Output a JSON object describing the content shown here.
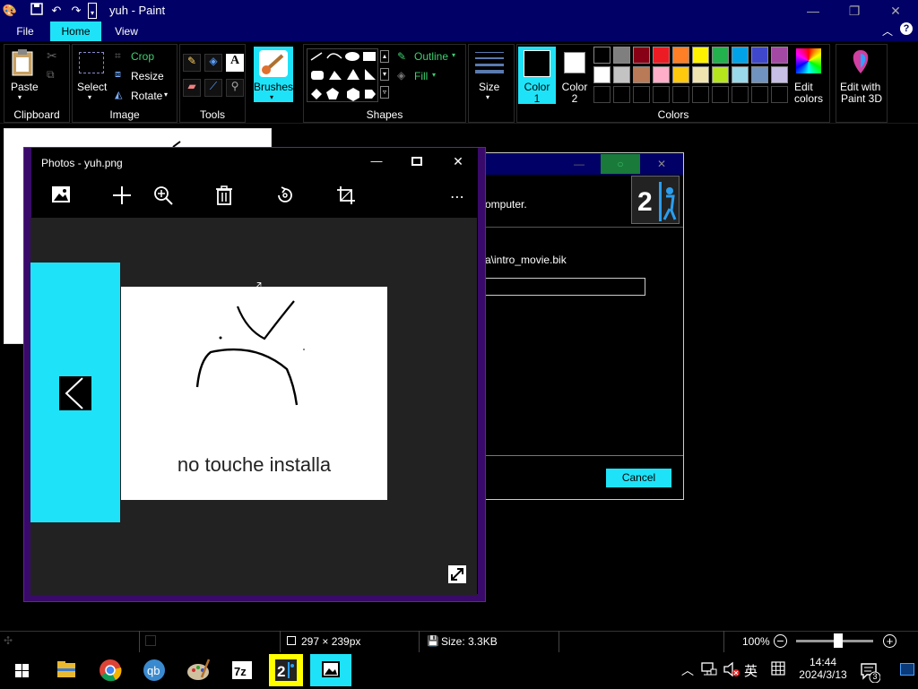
{
  "window": {
    "title": "yuh - Paint"
  },
  "menu": {
    "tabs": [
      {
        "label": "File"
      },
      {
        "label": "Home"
      },
      {
        "label": "View"
      }
    ]
  },
  "ribbon": {
    "clipboard": {
      "paste": "Paste",
      "group": "Clipboard"
    },
    "image": {
      "select": "Select",
      "crop": "Crop",
      "resize": "Resize",
      "rotate": "Rotate",
      "group": "Image"
    },
    "tools": {
      "group": "Tools"
    },
    "brushes": {
      "label": "Brushes"
    },
    "shapes": {
      "outline": "Outline",
      "fill": "Fill",
      "group": "Shapes"
    },
    "size": {
      "label": "Size"
    },
    "colors": {
      "color1": "Color\n1",
      "color1_a": "Color",
      "color1_b": "1",
      "color2_a": "Color",
      "color2_b": "2",
      "edit": "Edit",
      "edit2": "colors",
      "group": "Colors",
      "palette_row1": [
        "#000000",
        "#7f7f7f",
        "#880015",
        "#ed1c24",
        "#ff7f27",
        "#fff200",
        "#22b14c",
        "#00a2e8",
        "#3f48cc",
        "#a349a4"
      ],
      "palette_row2": [
        "#ffffff",
        "#c3c3c3",
        "#b97a57",
        "#ffaec9",
        "#ffc90e",
        "#efe4b0",
        "#b5e61d",
        "#99d9ea",
        "#7092be",
        "#c8bfe7"
      ]
    },
    "paint3d": {
      "line1": "Edit with",
      "line2": "Paint 3D"
    }
  },
  "installer": {
    "text1": "omputer.",
    "path": "a\\intro_movie.bik",
    "cancel": "Cancel"
  },
  "photos": {
    "title": "Photos - yuh.png",
    "image_caption": "no touche installa"
  },
  "statusbar": {
    "dimensions": "297 × 239px",
    "size": "Size: 3.3KB",
    "zoom": "100%",
    "zoom_level": 0.55
  },
  "taskbar": {
    "ime": "英",
    "time": "14:44",
    "date": "2024/3/13",
    "notifications": "3"
  },
  "colors": {
    "accent": "#1ee3f8",
    "title_bar": "#000066"
  }
}
